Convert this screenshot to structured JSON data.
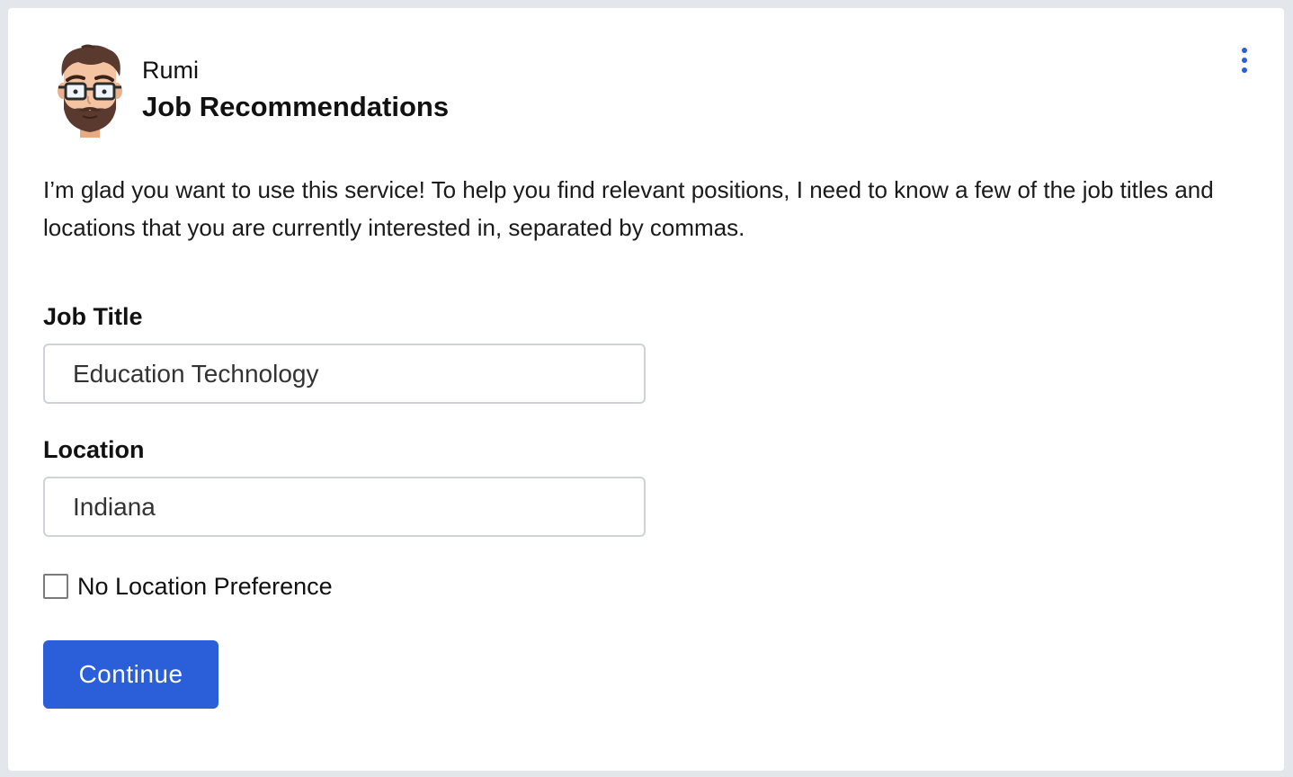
{
  "header": {
    "bot_name": "Rumi",
    "title": "Job Recommendations",
    "avatar_icon": "bearded-man-avatar-icon",
    "menu_icon": "vertical-dots-icon"
  },
  "intro_text": "I’m glad you want to use this service! To help you find relevant positions, I need to know a few of the job titles and locations that you are currently interested in, separated by commas.",
  "form": {
    "job_title": {
      "label": "Job Title",
      "value": "Education Technology"
    },
    "location": {
      "label": "Location",
      "value": "Indiana"
    },
    "no_location_preference": {
      "label": "No Location Preference",
      "checked": false
    },
    "continue_label": "Continue"
  },
  "colors": {
    "accent": "#2b5fd9",
    "background": "#e3e6ea",
    "card": "#ffffff"
  }
}
